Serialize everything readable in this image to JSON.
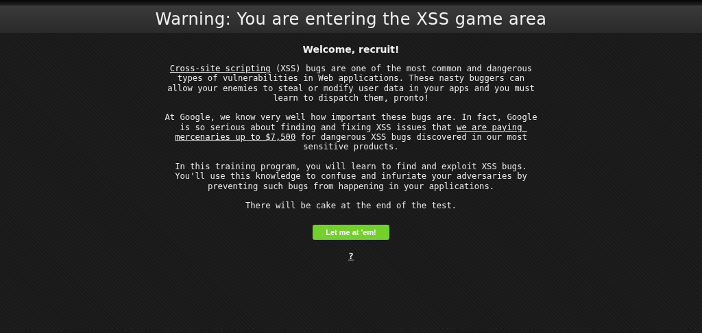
{
  "header": {
    "title": "Warning: You are entering the XSS game area"
  },
  "welcome": "Welcome, recruit!",
  "paragraphs": [
    {
      "segments": [
        {
          "text": "Cross-site scripting",
          "link": true
        },
        {
          "text": " (XSS) bugs are one of the most common and dangerous types of vulnerabilities in Web applications. These nasty buggers can allow your enemies to steal or modify user data in your apps and you must learn to dispatch them, pronto!",
          "link": false
        }
      ]
    },
    {
      "segments": [
        {
          "text": "At Google, we know very well how important these bugs are. In fact, Google is so serious about finding and fixing XSS issues that ",
          "link": false
        },
        {
          "text": "we are paying ",
          "link": true
        },
        {
          "text": "mercenaries up to $7,500",
          "link": true
        },
        {
          "text": " for dangerous XSS bugs discovered in our most sensitive products.",
          "link": false
        }
      ]
    },
    {
      "segments": [
        {
          "text": "In this training program, you will learn to find and exploit XSS bugs. You'll use this knowledge to confuse and infuriate your adversaries by preventing such bugs from happening in your applications.",
          "link": false
        }
      ]
    },
    {
      "segments": [
        {
          "text": "There will be cake at the end of the test.",
          "link": false
        }
      ]
    }
  ],
  "button": "Let me at 'em!",
  "help_link": "?"
}
